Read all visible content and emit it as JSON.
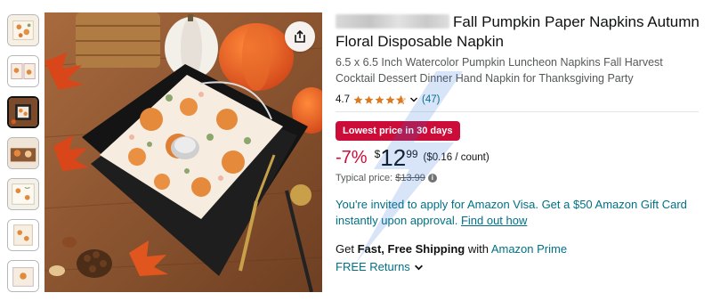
{
  "thumbnails": [
    {
      "name": "thumbnail-1",
      "active": false
    },
    {
      "name": "thumbnail-2",
      "active": false
    },
    {
      "name": "thumbnail-3",
      "active": true
    },
    {
      "name": "thumbnail-4",
      "active": false
    },
    {
      "name": "thumbnail-5",
      "active": false
    },
    {
      "name": "thumbnail-6",
      "active": false
    },
    {
      "name": "thumbnail-7",
      "active": false
    }
  ],
  "main_image": {
    "icon": "share-icon"
  },
  "product": {
    "title": "Fall Pumpkin Paper Napkins Autumn Floral Disposable Napkin",
    "subtitle": "6.5 x 6.5 Inch Watercolor Pumpkin Luncheon Napkins Fall Harvest Cocktail Dessert Dinner Hand Napkin for Thanksgiving Party",
    "rating": "4.7",
    "rating_stars": 4.7,
    "review_count": "(47)"
  },
  "pricing": {
    "deal_badge": "Lowest price in 30 days",
    "discount": "-7%",
    "currency": "$",
    "price_whole": "12",
    "price_fraction": "99",
    "unit_price": "($0.16 / count)",
    "typical_label": "Typical price:",
    "typical_price": "$13.99",
    "info_icon_glyph": "i"
  },
  "promo": {
    "text": "You're invited to apply for Amazon Visa. Get a $50 Amazon Gift Card instantly upon approval.",
    "link": "Find out how"
  },
  "shipping": {
    "prefix": "Get ",
    "highlight": "Fast, Free Shipping",
    "middle": " with ",
    "prime_link": "Amazon Prime",
    "returns_label": "FREE Returns"
  },
  "colors": {
    "deal_red": "#cc0c39",
    "link_teal": "#007185",
    "star_orange": "#de7921"
  }
}
